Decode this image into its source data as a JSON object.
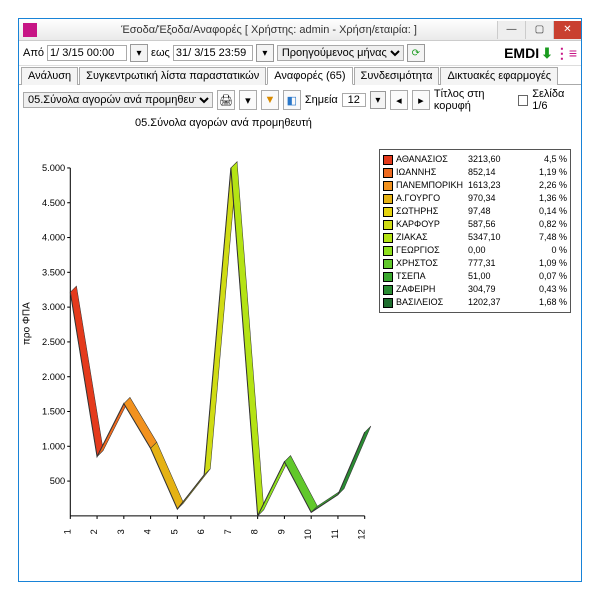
{
  "window": {
    "title": "Έσοδα/Έξοδα/Αναφορές   [ Χρήστης: admin - Χρήση/εταιρία:                 ]"
  },
  "toolbar": {
    "from_label": "Από",
    "from_value": "1/ 3/15 00:00",
    "to_label": "εως",
    "to_value": "31/ 3/15 23:59",
    "period": "Προηγούμενος μήνας"
  },
  "tabs": [
    "Ανάλυση",
    "Συγκεντρωτική λίστα παραστατικών",
    "Αναφορές (65)",
    "Συνδεσιμότητα",
    "Δικτυακές εφαρμογές"
  ],
  "active_tab": 2,
  "reportbar": {
    "report": "05.Σύνολα αγορών ανά προμηθευτή",
    "points_label": "Σημεία",
    "points_value": "12",
    "title_label": "Τίτλος στη κορυφή",
    "page_label": "Σελίδα 1/6"
  },
  "chart_data": {
    "type": "line",
    "title": "05.Σύνολα αγορών ανά προμηθευτή",
    "ylabel": "προ ΦΠΑ",
    "ylim": [
      0,
      5000
    ],
    "yticks": [
      500,
      1000,
      1500,
      2000,
      2500,
      3000,
      3500,
      4000,
      4500,
      5000
    ],
    "categories": [
      "1",
      "2",
      "3",
      "4",
      "5",
      "6",
      "7",
      "8",
      "9",
      "10",
      "11",
      "12"
    ],
    "values": [
      3213.6,
      852.14,
      1613.23,
      970.34,
      97.48,
      587.56,
      5347.1,
      0.0,
      777.31,
      51.0,
      304.79,
      1202.37
    ],
    "series_colors": [
      "#e43a1c",
      "#ee6a1f",
      "#f2921f",
      "#e5b214",
      "#e5d40f",
      "#d0dc14",
      "#b4e314",
      "#8fe01e",
      "#61c82b",
      "#3aa82f",
      "#2a8c33",
      "#1f6e2f"
    ]
  },
  "legend": [
    {
      "name": "ΑΘΑΝΑΣΙΟΣ",
      "value": "3213,60",
      "pct": "4,5 %",
      "color": "#e43a1c"
    },
    {
      "name": "ΙΩΑΝΝΗΣ",
      "value": "852,14",
      "pct": "1,19 %",
      "color": "#ee6a1f"
    },
    {
      "name": "ΠΑΝΕΜΠΟΡΙΚΗ",
      "value": "1613,23",
      "pct": "2,26 %",
      "color": "#f2921f"
    },
    {
      "name": "Α.ΓΟΥΡΓΟ",
      "value": "970,34",
      "pct": "1,36 %",
      "color": "#e5b214"
    },
    {
      "name": "ΣΩΤΗΡΗΣ",
      "value": "97,48",
      "pct": "0,14 %",
      "color": "#e5d40f"
    },
    {
      "name": "ΚΑΡΦΟΥΡ",
      "value": "587,56",
      "pct": "0,82 %",
      "color": "#d0dc14"
    },
    {
      "name": "ΖΙΑΚΑΣ",
      "value": "5347,10",
      "pct": "7,48 %",
      "color": "#b4e314"
    },
    {
      "name": "ΓΕΩΡΓΙΟΣ",
      "value": "0,00",
      "pct": "0 %",
      "color": "#8fe01e"
    },
    {
      "name": "ΧΡΗΣΤΟΣ",
      "value": "777,31",
      "pct": "1,09 %",
      "color": "#61c82b"
    },
    {
      "name": "ΤΣΕΠΑ",
      "value": "51,00",
      "pct": "0,07 %",
      "color": "#3aa82f"
    },
    {
      "name": "ΖΑΦΕΙΡΗ",
      "value": "304,79",
      "pct": "0,43 %",
      "color": "#2a8c33"
    },
    {
      "name": "ΒΑΣΙΛΕΙΟΣ",
      "value": "1202,37",
      "pct": "1,68 %",
      "color": "#1f6e2f"
    }
  ]
}
